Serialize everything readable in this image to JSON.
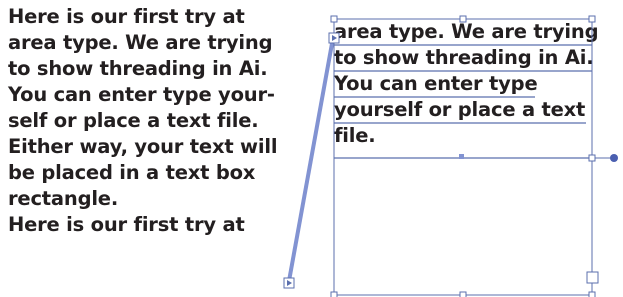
{
  "left_frame": {
    "lines": [
      "Here is our first try at",
      "area type. We are trying",
      "to show threading in Ai.",
      "You can enter type your-",
      "self or place a text file.",
      "Either way, your text will",
      "be placed in a text box",
      "rectangle.",
      "Here is our first try at"
    ]
  },
  "right_frame": {
    "lines": [
      "area type. We are trying",
      "to show threading in Ai.",
      "You can enter type",
      "yourself or place a text",
      "file."
    ]
  },
  "colors": {
    "text": "#231f20",
    "selection": "#5b6fae",
    "thread": "#7d8fcf"
  },
  "icons": {
    "out_port": "square-arrow-right-icon",
    "in_port": "square-arrow-right-icon",
    "thread_handle": "filled-circle-icon",
    "center_point": "square-dot-icon"
  }
}
